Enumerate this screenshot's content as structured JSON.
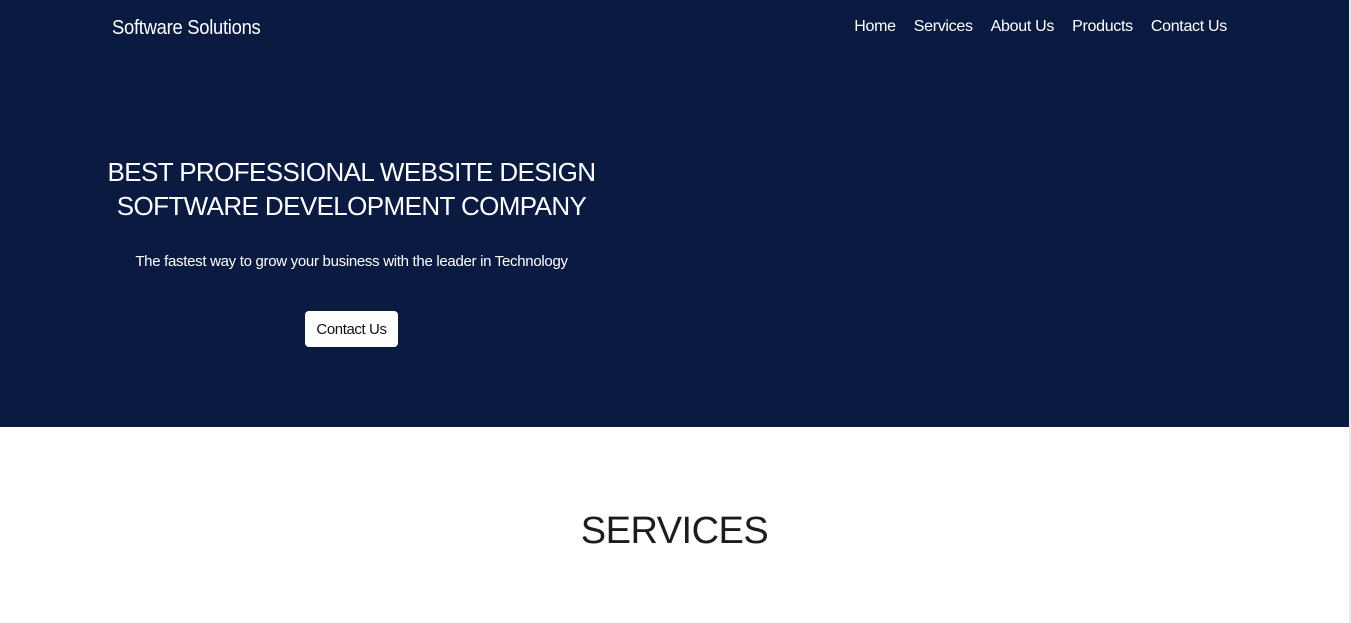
{
  "header": {
    "brand": "Software Solutions",
    "nav": [
      "Home",
      "Services",
      "About Us",
      "Products",
      "Contact Us"
    ]
  },
  "hero": {
    "title": "BEST PROFESSIONAL WEBSITE DESIGN SOFTWARE DEVELOPMENT COMPANY",
    "subtitle": "The fastest way to grow your business with the leader in Technology",
    "cta_label": "Contact Us"
  },
  "services": {
    "heading": "SERVICES"
  },
  "colors": {
    "hero_background": "#0b1a40",
    "page_background": "#ffffff",
    "hero_text": "#ffffff",
    "heading_text": "#1c1c1c"
  }
}
